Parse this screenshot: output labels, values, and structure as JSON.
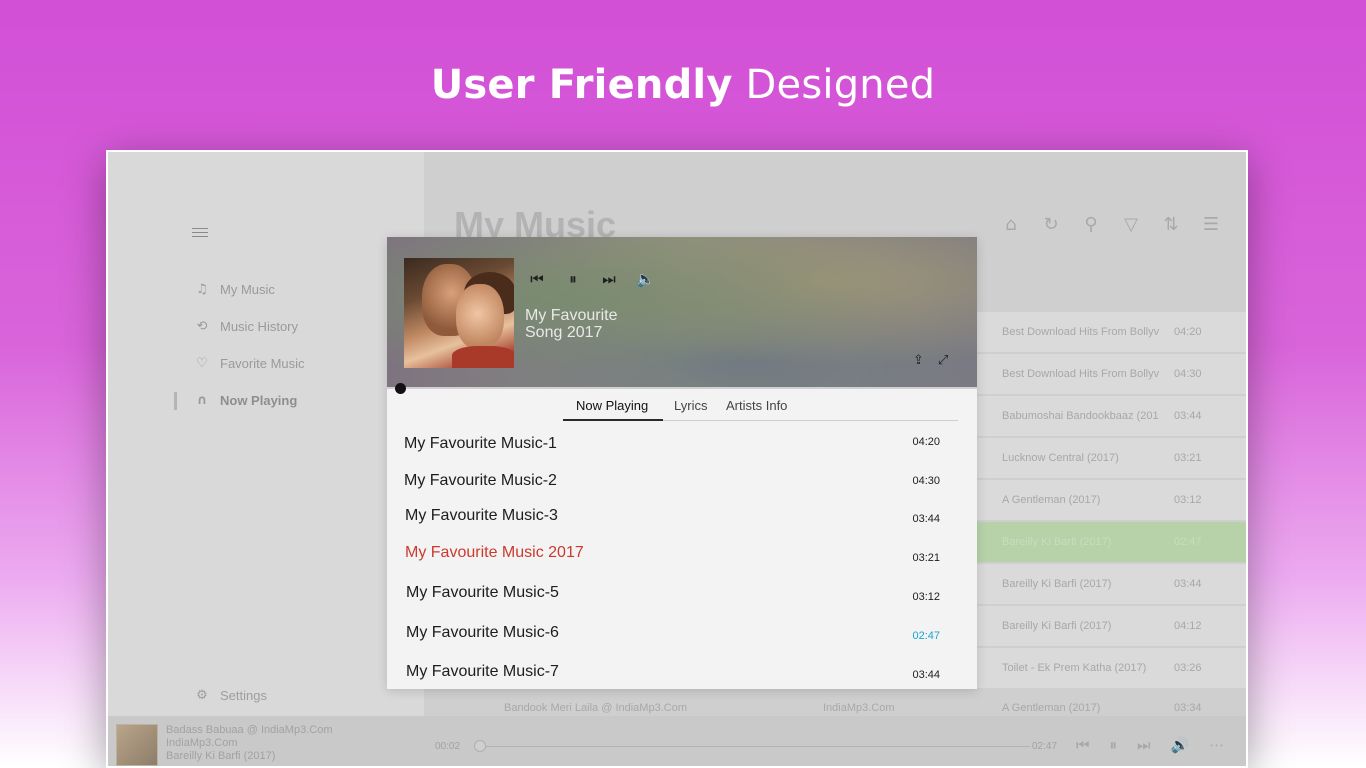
{
  "headline": {
    "bold": "User Friendly",
    "light": "Designed"
  },
  "sidebar": {
    "items": [
      {
        "label": "My Music",
        "icon": "music-note-icon"
      },
      {
        "label": "Music History",
        "icon": "history-icon"
      },
      {
        "label": "Favorite Music",
        "icon": "heart-icon"
      },
      {
        "label": "Now Playing",
        "icon": "headphones-icon"
      }
    ],
    "settings_label": "Settings"
  },
  "main": {
    "title": "My Music",
    "toolbar": [
      "home-icon",
      "refresh-icon",
      "search-icon",
      "filter-icon",
      "sort-icon",
      "queue-icon"
    ],
    "tracks": [
      {
        "album": "Best Download Hits From Bollyv",
        "duration": "04:20"
      },
      {
        "album": "Best Download Hits From Bollyv",
        "duration": "04:30"
      },
      {
        "album": "Babumoshai Bandookbaaz (201",
        "duration": "03:44"
      },
      {
        "album": "Lucknow Central (2017)",
        "duration": "03:21"
      },
      {
        "album": "A Gentleman (2017)",
        "duration": "03:12"
      },
      {
        "album": "Bareilly Ki Barfi (2017)",
        "duration": "02:47"
      },
      {
        "album": "Bareilly Ki Barfi (2017)",
        "duration": "03:44"
      },
      {
        "album": "Bareilly Ki Barfi (2017)",
        "duration": "04:12"
      },
      {
        "album": "Toilet - Ek Prem Katha (2017)",
        "duration": "03:26"
      }
    ],
    "bottom_row": {
      "title": "Bandook Meri Laila @ IndiaMp3.Com",
      "artist": "IndiaMp3.Com",
      "album": "A Gentleman (2017)",
      "duration": "03:34"
    }
  },
  "player_bar": {
    "title": "Badass Babuaa @ IndiaMp3.Com",
    "artist": "IndiaMp3.Com",
    "album": "Bareilly Ki Barfi (2017)",
    "elapsed": "00:02",
    "total": "02:47"
  },
  "now_playing": {
    "song_title": "My Favourite Song 2017",
    "tabs": [
      "Now Playing",
      "Lyrics",
      "Artists Info"
    ],
    "list": [
      {
        "title": "My Favourite Music-1",
        "duration": "04:20"
      },
      {
        "title": "My Favourite Music-2",
        "duration": "04:30"
      },
      {
        "title": "My Favourite Music-3",
        "duration": "03:44"
      },
      {
        "title": "My Favourite Music 2017",
        "duration": "03:21"
      },
      {
        "title": "My Favourite Music-5",
        "duration": "03:12"
      },
      {
        "title": "My Favourite Music-6",
        "duration": "02:47"
      },
      {
        "title": "My Favourite Music-7",
        "duration": "03:44"
      }
    ],
    "colors": {
      "current_title": "#cb3a2f",
      "accent_duration": "#19a5cf"
    }
  }
}
